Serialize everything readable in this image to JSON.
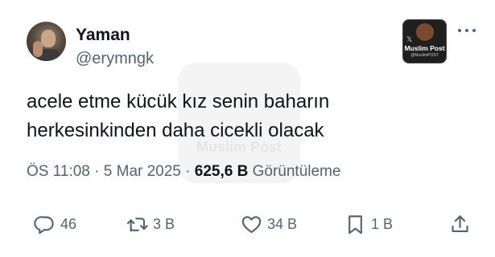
{
  "author": {
    "display_name": "Yaman",
    "handle": "@erymngk",
    "avatar_icon": "profile-photo"
  },
  "badge": {
    "title": "Muslim Post",
    "subtitle": "@MuslimPOST",
    "x_glyph": "𝕏"
  },
  "more_icon": "more-horizontal-icon",
  "tweet": {
    "lines": [
      "acele etme kücük kız senin baharın",
      "herkesinkinden daha cicekli olacak"
    ]
  },
  "watermark": {
    "text": "Muslim Post"
  },
  "meta": {
    "time": "ÖS 11:08",
    "separator": " · ",
    "date": "5 Mar 2025",
    "separator2": " · ",
    "views": "625,6 B",
    "views_label": " Görüntüleme"
  },
  "actions": {
    "reply_count": "46",
    "retweet_count": "3 B",
    "like_count": "34 B",
    "bookmark_count": "1 B"
  },
  "colors": {
    "text_primary": "#0f1419",
    "text_secondary": "#536471",
    "background": "#ffffff"
  }
}
